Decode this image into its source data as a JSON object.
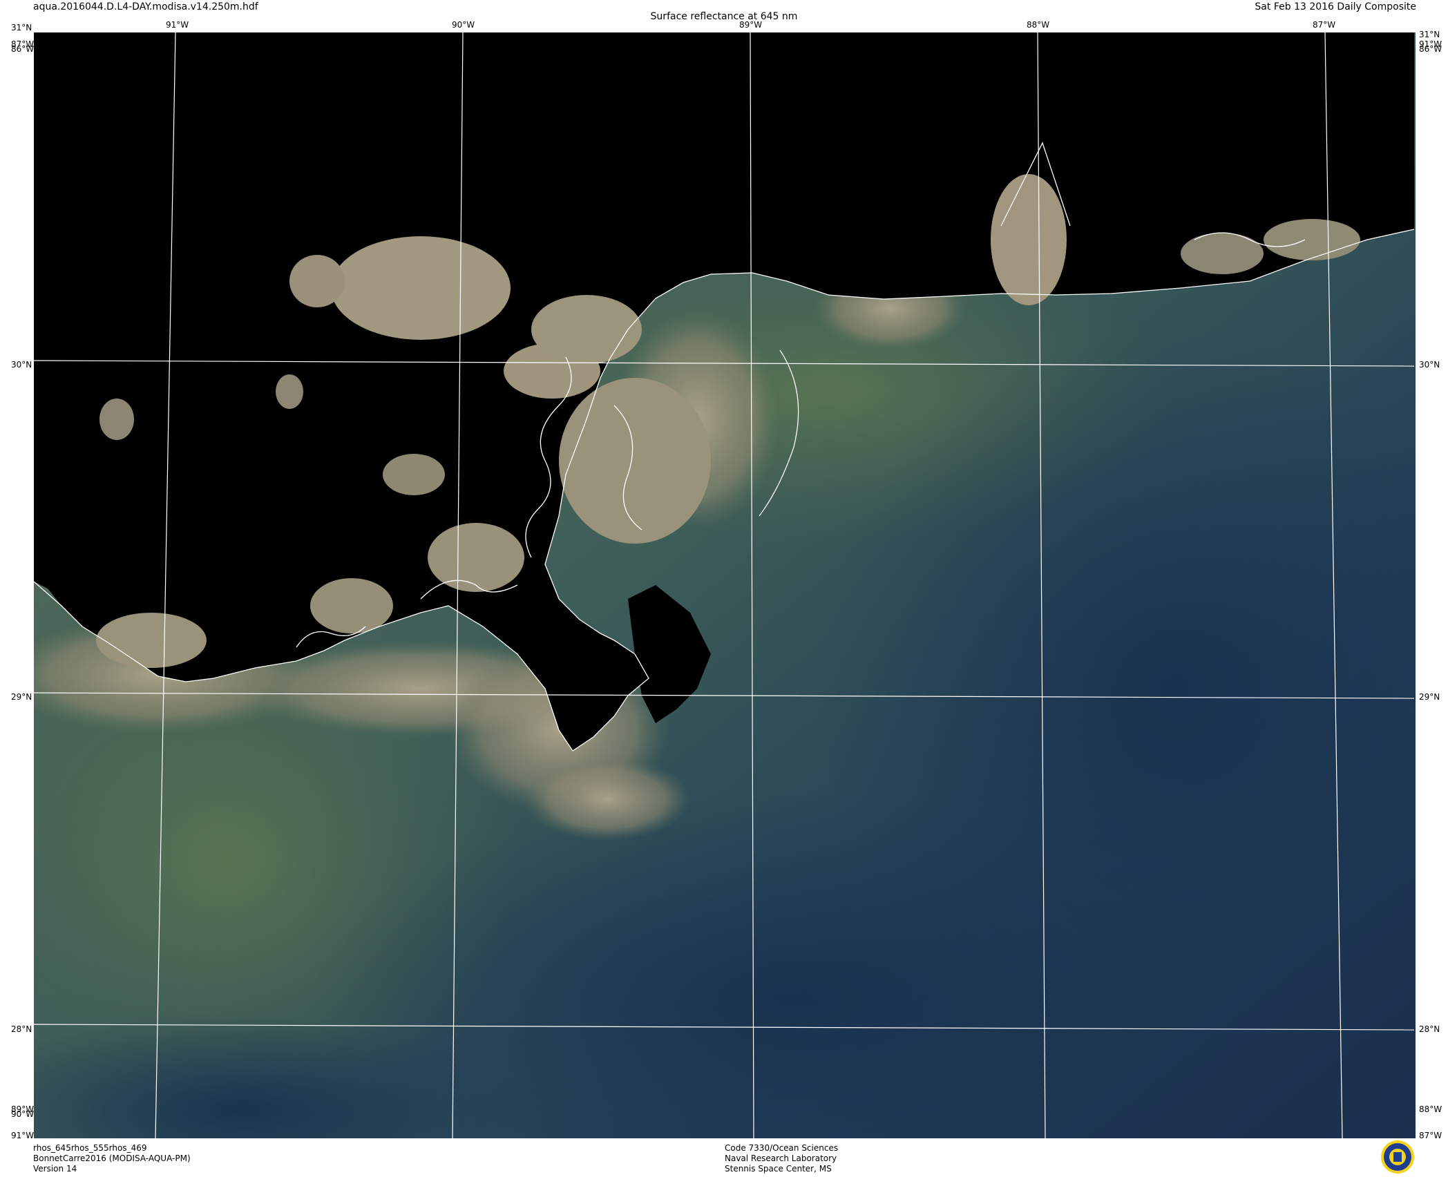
{
  "header": {
    "file_name": "aqua.2016044.D.L4-DAY.modisa.v14.250m.hdf",
    "title": "Surface reflectance at 645 nm",
    "composite_label": "Sat Feb 13 2016 Daily Composite"
  },
  "map": {
    "lon_top": [
      "91°W",
      "90°W",
      "89°W",
      "88°W",
      "87°W"
    ],
    "lat_left": [
      "31°N",
      "30°N",
      "29°N",
      "28°N"
    ],
    "lat_right": [
      "31°N",
      "30°N",
      "29°N",
      "28°N"
    ],
    "corner_top_left": [
      "31°N",
      "87°W",
      "86°W"
    ],
    "corner_top_right": [
      "31°N",
      "91°W",
      "86°W"
    ],
    "corner_bottom_left": [
      "89°W",
      "90°W",
      "91°W"
    ],
    "corner_bottom_right": [
      "88°W",
      "87°W"
    ],
    "colors": {
      "land_mask": "#000000",
      "grid_lines": "#ffffff",
      "coastline": "#ffffff",
      "turbid_water": "#a39a83",
      "green_water": "#4f6a52",
      "deep_water": "#1c3550"
    }
  },
  "footer": {
    "left": [
      "rhos_645rhos_555rhos_469",
      "BonnetCarre2016 (MODISA-AQUA-PM)",
      "Version 14"
    ],
    "center": [
      "Code 7330/Ocean Sciences",
      "Naval Research Laboratory",
      "Stennis Space Center, MS"
    ]
  },
  "logo": {
    "icon": "nrl-seal-icon"
  }
}
